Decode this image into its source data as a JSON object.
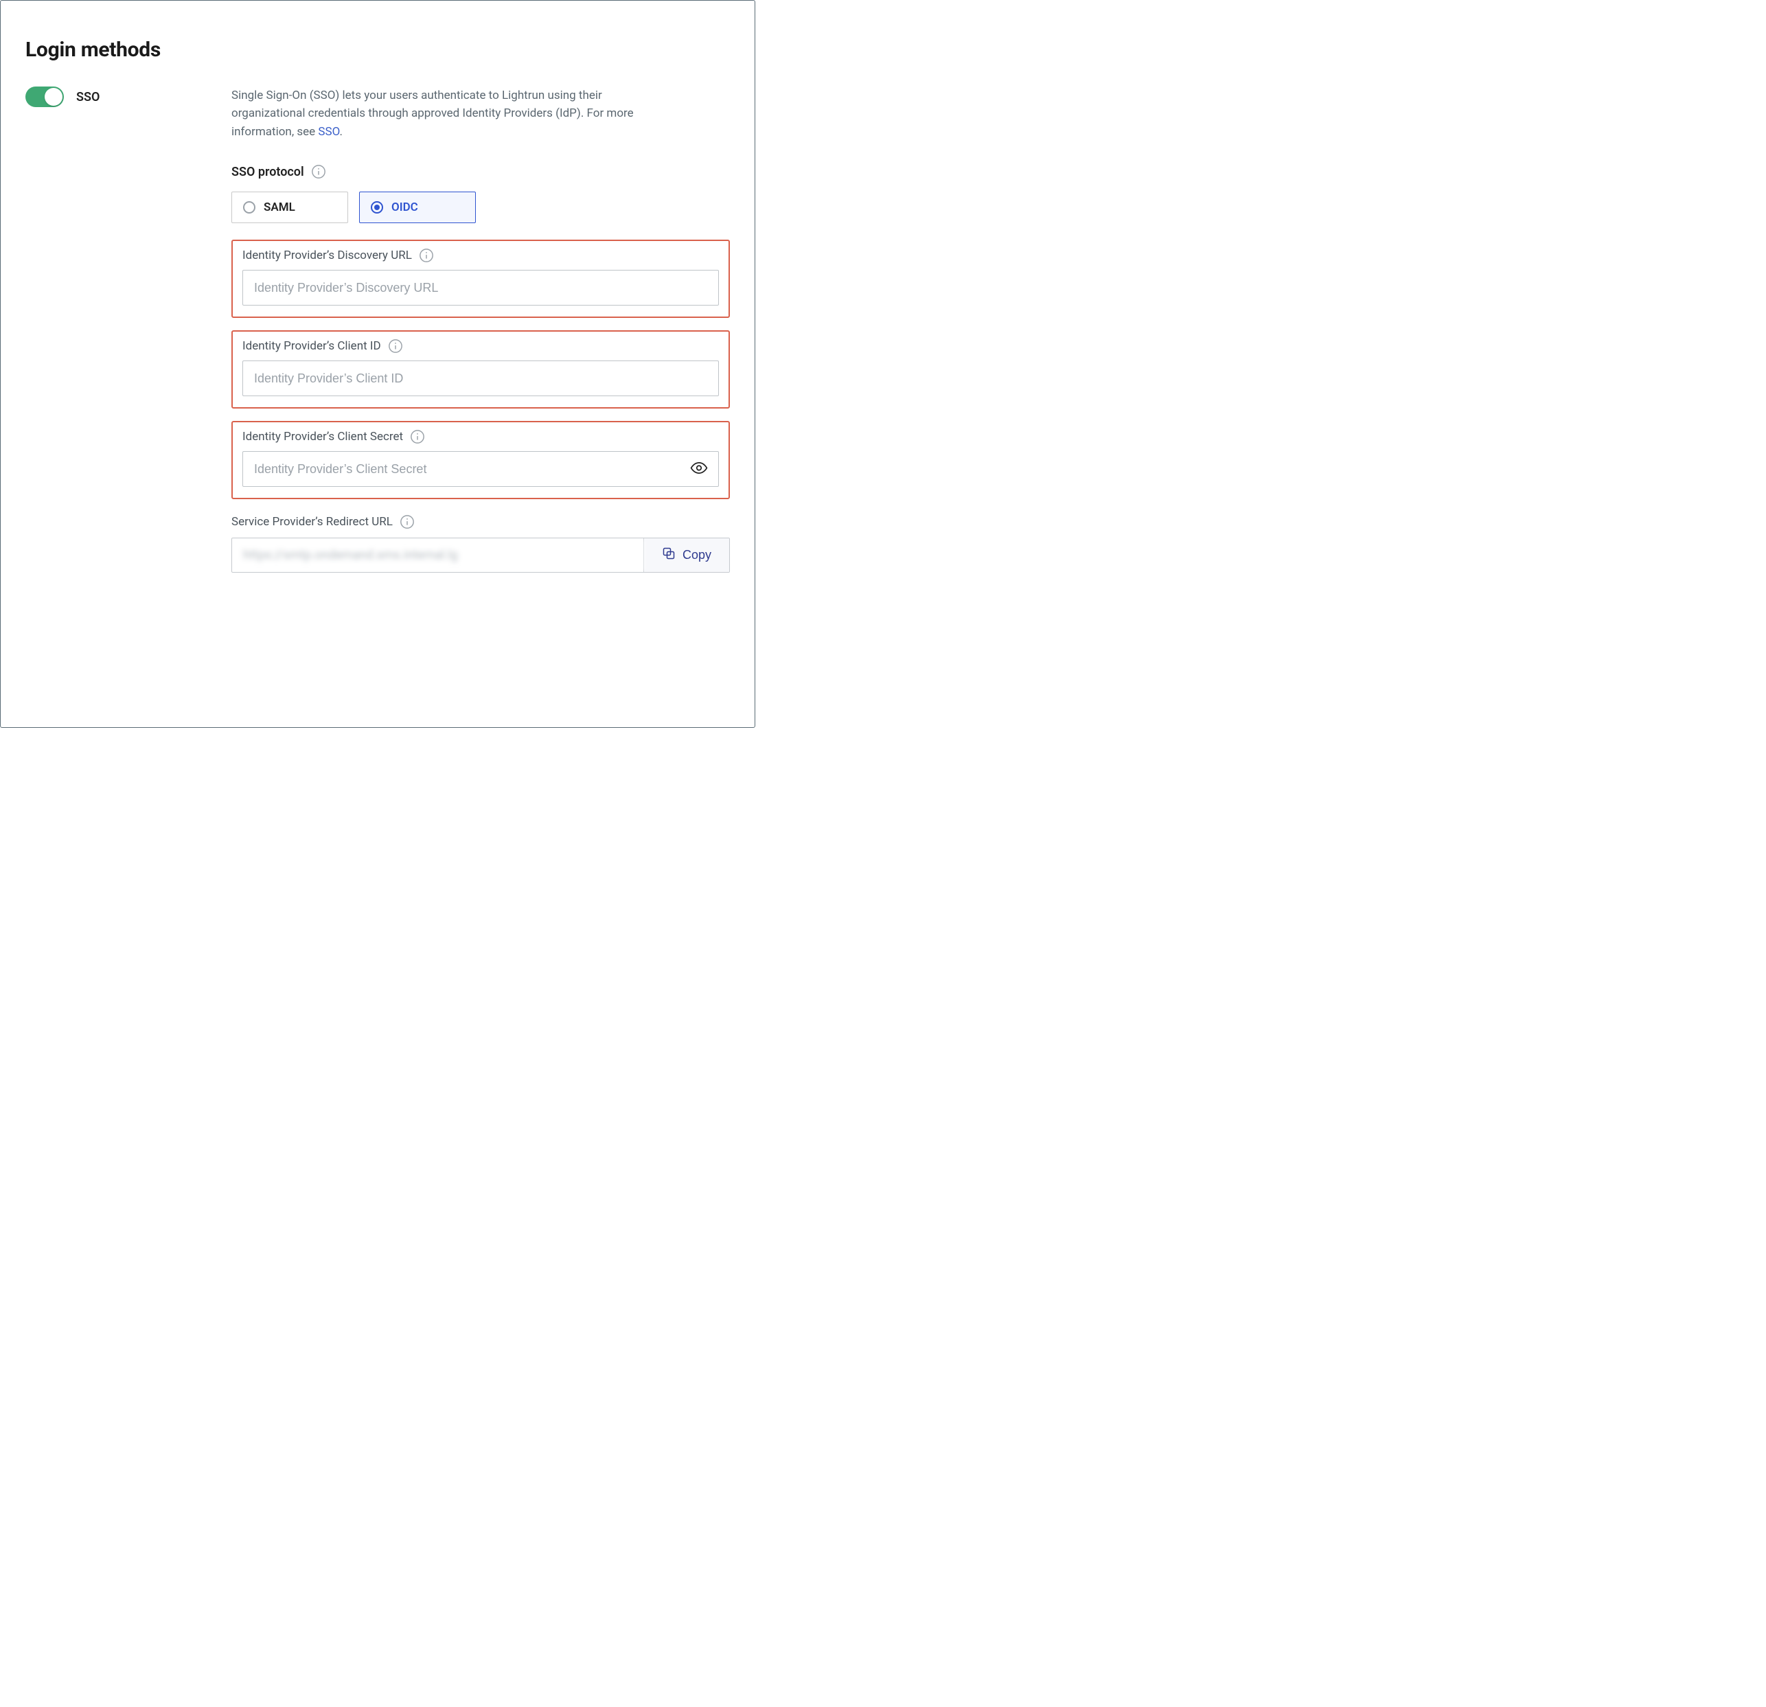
{
  "page_title": "Login methods",
  "sso": {
    "toggle_label": "SSO",
    "enabled": true,
    "description_part1": "Single Sign-On (SSO) lets your users authenticate to Lightrun using their organizational credentials through approved Identity Providers (IdP). For more information, see ",
    "description_link_text": "SSO",
    "description_part2": "."
  },
  "protocol": {
    "label": "SSO protocol",
    "options": [
      {
        "id": "saml",
        "label": "SAML",
        "selected": false
      },
      {
        "id": "oidc",
        "label": "OIDC",
        "selected": true
      }
    ]
  },
  "fields": {
    "discovery_url": {
      "label": "Identity Provider’s Discovery URL",
      "placeholder": "Identity Provider’s Discovery URL",
      "value": ""
    },
    "client_id": {
      "label": "Identity Provider’s Client ID",
      "placeholder": "Identity Provider’s Client ID",
      "value": ""
    },
    "client_secret": {
      "label": "Identity Provider’s Client Secret",
      "placeholder": "Identity Provider’s Client Secret",
      "value": ""
    },
    "redirect_url": {
      "label": "Service Provider’s Redirect URL",
      "value_display": "https://smtp.ondemand.sms.internal.lg",
      "copy_label": "Copy"
    }
  },
  "colors": {
    "toggle_on": "#3fa873",
    "highlight_border": "#d9614c",
    "accent": "#2f54d0",
    "link": "#3a5fc9"
  }
}
